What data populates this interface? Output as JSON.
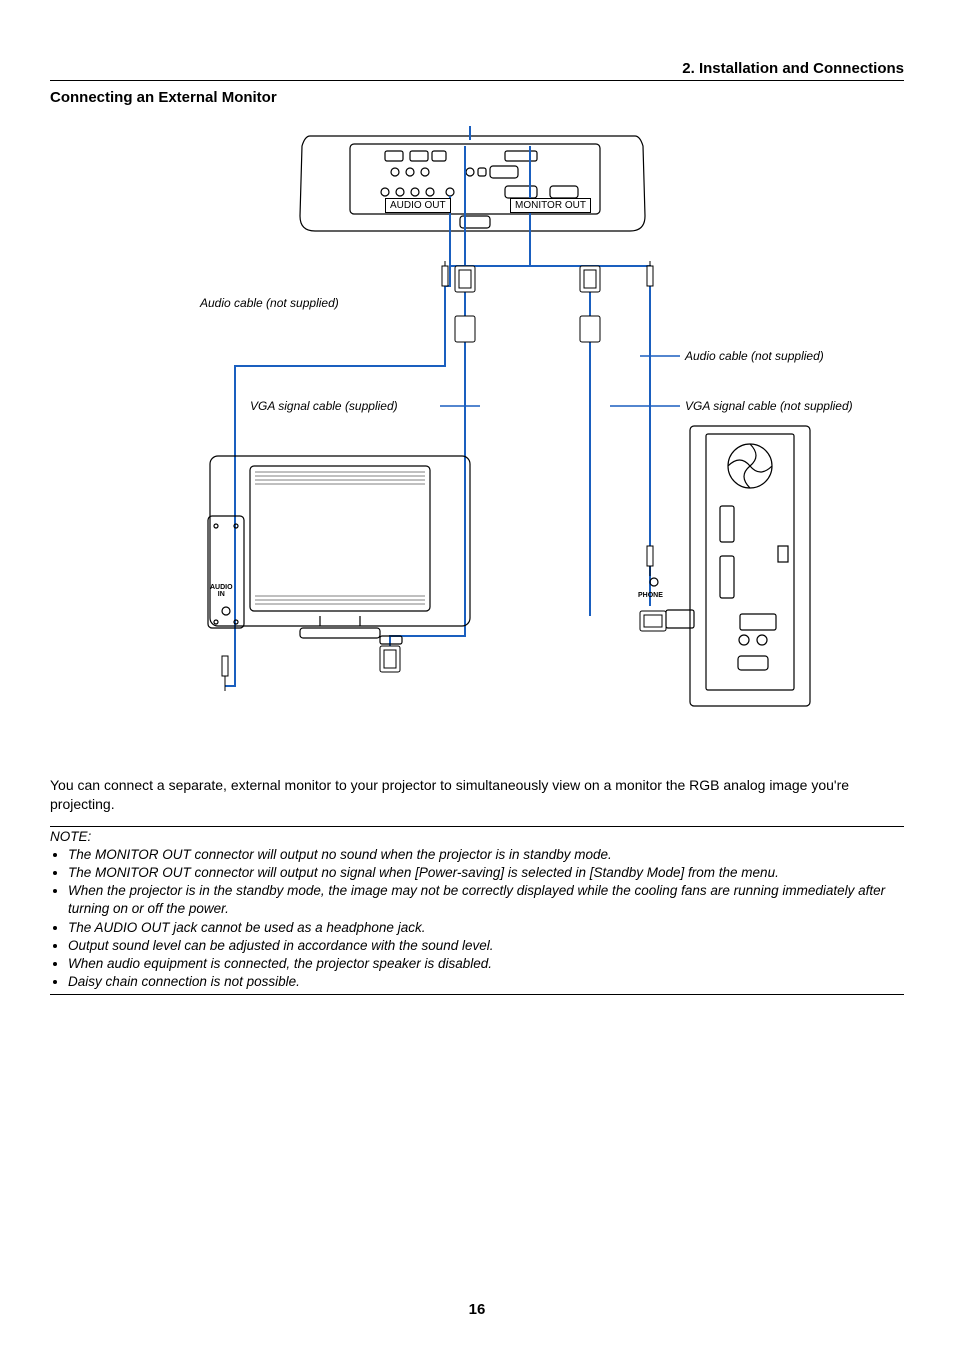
{
  "header": {
    "chapter": "2. Installation and Connections"
  },
  "section": {
    "title": "Connecting an External Monitor"
  },
  "diagram": {
    "port_audio_out": "AUDIO OUT",
    "port_monitor_out": "MONITOR OUT",
    "label_audio_cable_left": "Audio cable (not supplied)",
    "label_audio_cable_right": "Audio cable (not supplied)",
    "label_vga_supplied": "VGA signal cable (supplied)",
    "label_vga_not_supplied": "VGA signal cable (not supplied)",
    "monitor_audio_in": "AUDIO\nIN",
    "pc_phone": "PHONE"
  },
  "body": {
    "intro": "You can connect a separate, external monitor to your projector to simultaneously view on a monitor the RGB analog image you're projecting."
  },
  "note": {
    "heading": "NOTE:",
    "items": [
      "The MONITOR OUT connector will output no sound when the projector is in standby mode.",
      "The MONITOR OUT connector will output no signal when [Power-saving] is selected in [Standby Mode] from the menu.",
      "When the projector is in the standby mode, the image may not be correctly displayed while the cooling fans are running immediately after turning on or off the power.",
      "The AUDIO OUT jack cannot be used as a headphone jack.",
      "Output sound level can be adjusted in accordance with the sound level.",
      "When audio equipment is connected, the projector speaker is disabled.",
      "Daisy chain connection is not possible."
    ]
  },
  "page_number": "16"
}
